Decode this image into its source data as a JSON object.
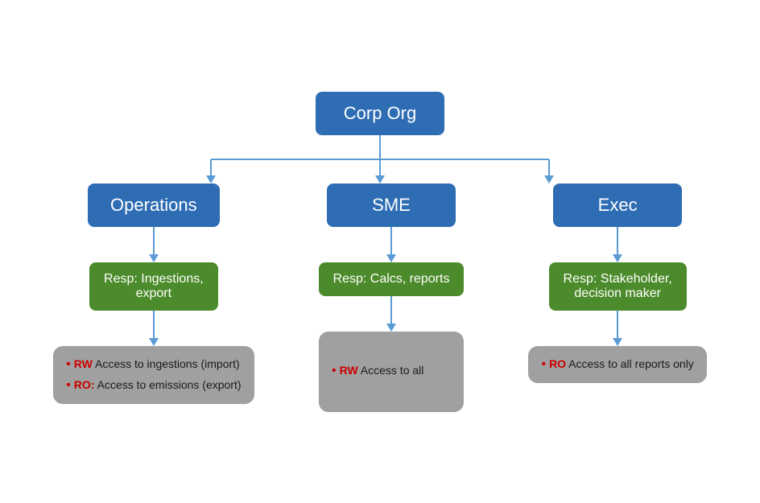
{
  "diagram": {
    "root": {
      "label": "Corp Org"
    },
    "branches": [
      {
        "id": "operations",
        "title": "Operations",
        "resp": "Resp: Ingestions,\nexport",
        "access_items": [
          {
            "prefix": "RW",
            "text": " Access to ingestions (import)"
          },
          {
            "prefix": "RO:",
            "text": " Access to emissions (export)"
          }
        ]
      },
      {
        "id": "sme",
        "title": "SME",
        "resp": "Resp: Calcs, reports",
        "access_items": [
          {
            "prefix": "RW",
            "text": " Access to all"
          }
        ]
      },
      {
        "id": "exec",
        "title": "Exec",
        "resp": "Resp: Stakeholder,\ndecision maker",
        "access_items": [
          {
            "prefix": "RO",
            "text": " Access to all reports only"
          }
        ]
      }
    ]
  }
}
